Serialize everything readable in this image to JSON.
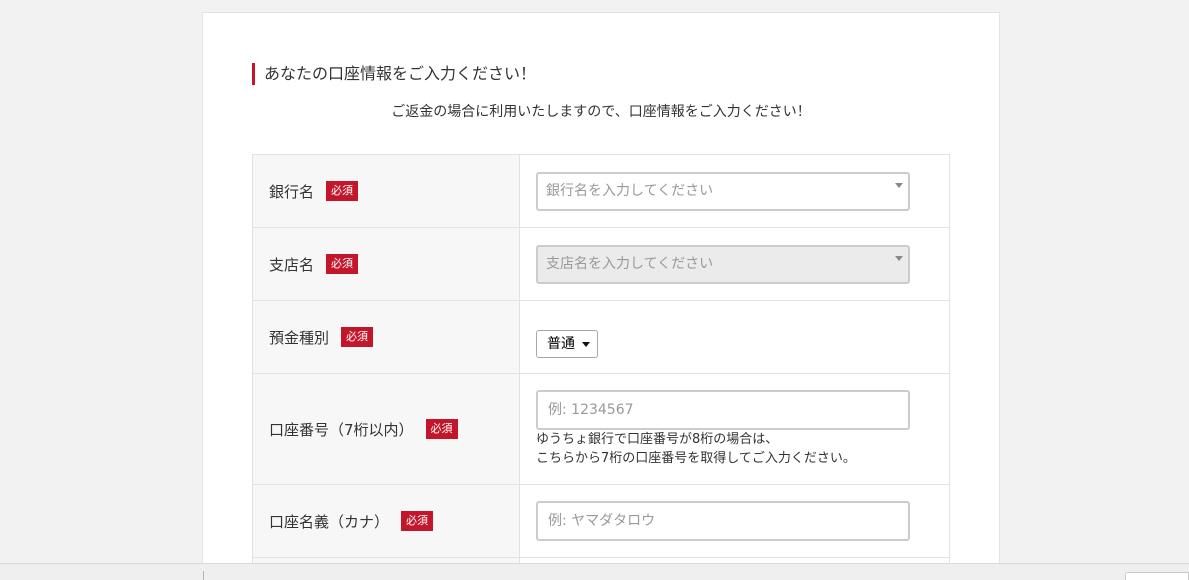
{
  "heading": "あなたの口座情報をご入力ください！",
  "subtext": "ご返金の場合に利用いたしますので、口座情報をご入力ください！",
  "required_badge": "必須",
  "fields": {
    "bank_name": {
      "label": "銀行名",
      "placeholder": "銀行名を入力してください"
    },
    "branch_name": {
      "label": "支店名",
      "placeholder": "支店名を入力してください"
    },
    "account_type": {
      "label": "預金種別",
      "selected": "普通"
    },
    "account_number": {
      "label": "口座番号（7桁以内）",
      "placeholder": "例: 1234567",
      "note_line1": "ゆうちょ銀行で口座番号が8桁の場合は、",
      "note_line2": "こちらから7桁の口座番号を取得してご入力ください。"
    },
    "account_holder": {
      "label": "口座名義（カナ）",
      "placeholder": "例: ヤマダタロウ"
    }
  },
  "colors": {
    "accent": "#c4162a",
    "label_bg": "#f7f7f7",
    "disabled_bg": "#ebebeb",
    "page_bg": "#f2f2f2"
  }
}
